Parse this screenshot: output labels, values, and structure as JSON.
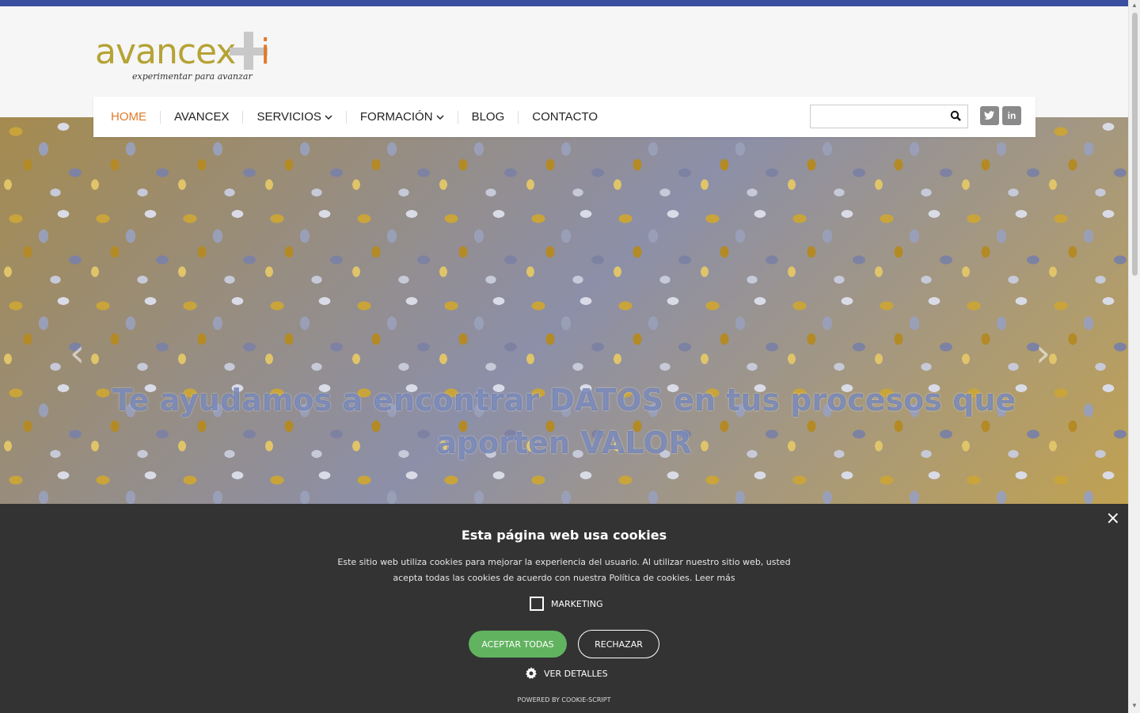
{
  "brand": {
    "logo_main": "avancex",
    "logo_i": "i",
    "tagline": "experimentar para avanzar"
  },
  "colors": {
    "topbar": "#3b4fa0",
    "nav_active": "#e07a2a",
    "logo_green": "#b5a335",
    "cookie_bg": "#333333",
    "accept_green": "#61b35f"
  },
  "nav": {
    "items": [
      {
        "label": "HOME",
        "active": true
      },
      {
        "label": "AVANCEX"
      },
      {
        "label": "SERVICIOS",
        "has_dropdown": true
      },
      {
        "label": "FORMACIÓN",
        "has_dropdown": true
      },
      {
        "label": "BLOG"
      },
      {
        "label": "CONTACTO"
      }
    ],
    "dropdown_icon": "chevron-down-icon"
  },
  "search": {
    "value": "",
    "icon": "search-icon"
  },
  "social": {
    "twitter_icon": "twitter-icon",
    "linkedin_label": "in"
  },
  "hero": {
    "title": "Te ayudamos a encontrar DATOS en tus procesos que aporten VALOR",
    "prev_icon": "chevron-left-icon",
    "next_icon": "chevron-right-icon"
  },
  "cookie": {
    "close_icon": "close-icon",
    "title": "Esta página web usa cookies",
    "text": "Este sitio web utiliza cookies para mejorar la experiencia del usuario. Al utilizar nuestro sitio web, usted acepta todas las cookies de acuerdo con nuestra Política de cookies.",
    "read_more": "Leer más",
    "marketing_label": "MARKETING",
    "marketing_checked": false,
    "accept_label": "ACEPTAR TODAS",
    "reject_label": "RECHAZAR",
    "details_label": "VER DETALLES",
    "powered_by": "POWERED BY COOKIE-SCRIPT"
  }
}
